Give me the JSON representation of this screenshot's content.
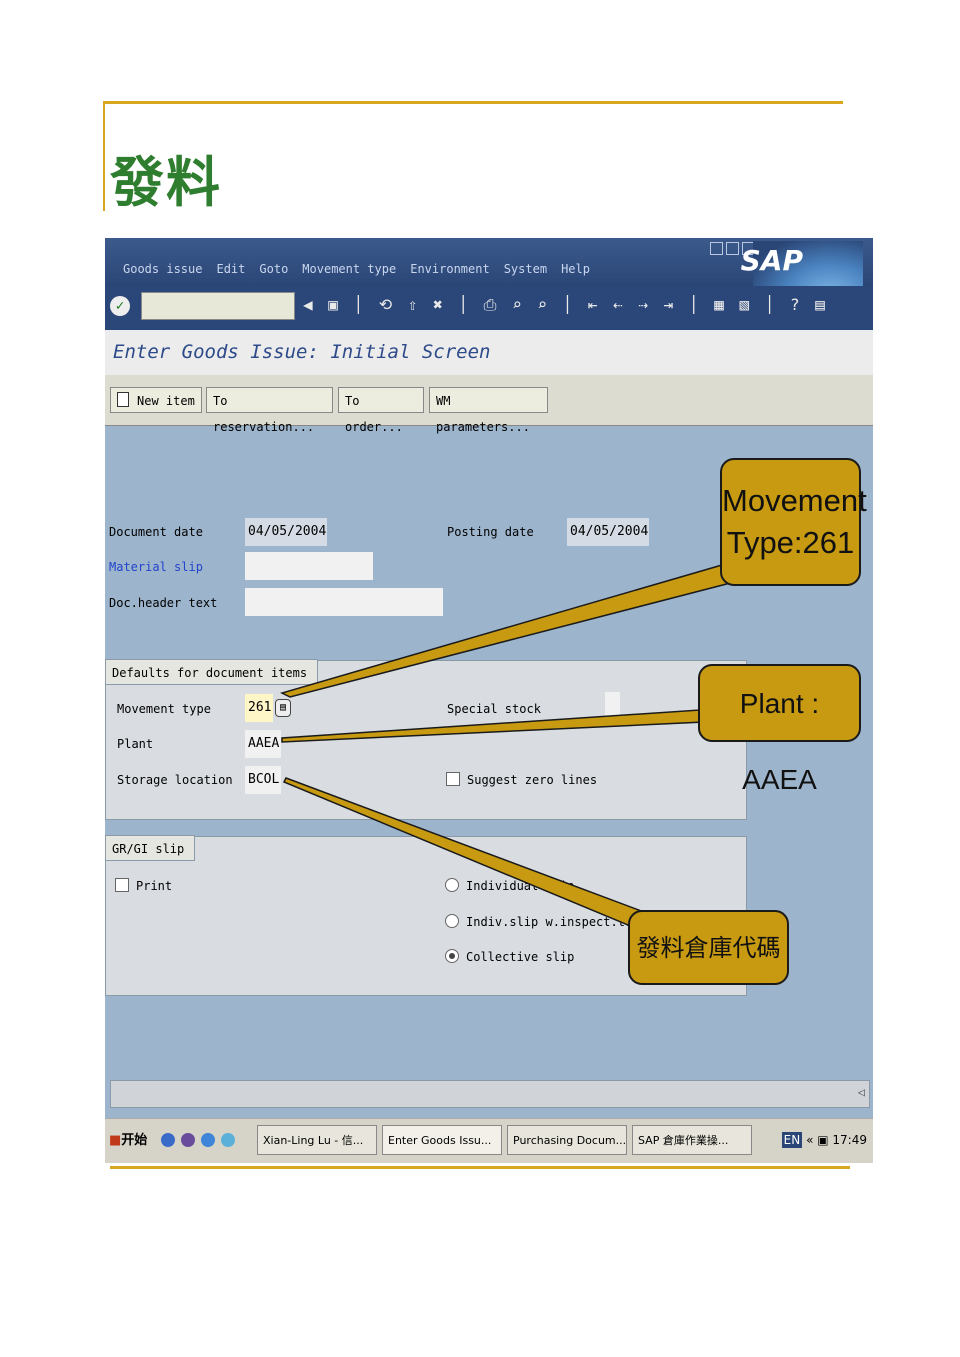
{
  "slide": {
    "title": "發料"
  },
  "menu": [
    "Goods issue",
    "Edit",
    "Goto",
    "Movement type",
    "Environment",
    "System",
    "Help"
  ],
  "brand": "SAP",
  "screen_title": "Enter Goods Issue: Initial Screen",
  "app_toolbar": {
    "new_item": "New item",
    "to_reservation": "To reservation...",
    "to_order": "To order...",
    "wm_parameters": "WM parameters..."
  },
  "header_fields": {
    "document_date_label": "Document date",
    "document_date": "04/05/2004",
    "posting_date_label": "Posting date",
    "posting_date": "04/05/2004",
    "material_slip_label": "Material slip",
    "material_slip": "",
    "doc_header_text_label": "Doc.header text",
    "doc_header_text": ""
  },
  "defaults_group": {
    "title": "Defaults for document items",
    "movement_type_label": "Movement type",
    "movement_type": "261",
    "plant_label": "Plant",
    "plant": "AAEA",
    "storage_location_label": "Storage location",
    "storage_location": "BCOL",
    "special_stock_label": "Special stock",
    "special_stock": "",
    "suggest_zero_lines_label": "Suggest zero lines"
  },
  "slip_group": {
    "title": "GR/GI slip",
    "print_label": "Print",
    "individual_slip_label": "Individual slip",
    "indiv_inspection_label": "Indiv.slip w.inspect.text",
    "collective_slip_label": "Collective slip",
    "selected": "collective"
  },
  "callouts": {
    "movement_type": "Movement Type:261",
    "plant": "Plant : AAEA",
    "storage": "發料倉庫代碼"
  },
  "taskbar": {
    "start": "开始",
    "tasks": [
      "Xian-Ling Lu - 信...",
      "Enter Goods Issu...",
      "Purchasing Docum...",
      "SAP 倉庫作業操..."
    ],
    "lang": "EN",
    "time": "17:49"
  },
  "colors": {
    "accent": "#d6a71f",
    "callout": "#c79a12",
    "sap_blue": "#2a4677",
    "screen_bg": "#9db5cc"
  }
}
